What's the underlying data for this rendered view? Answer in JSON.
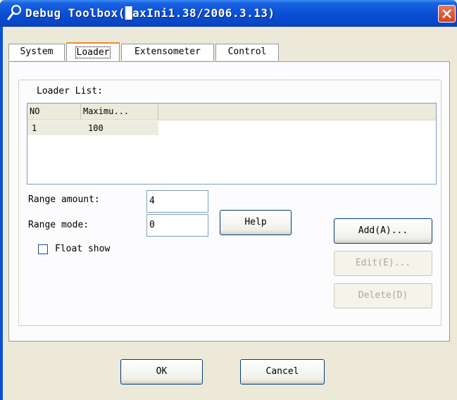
{
  "window": {
    "title": "Debug Toolbox(█axIni1.38/2006.3.13)"
  },
  "tabs": [
    {
      "label": "System",
      "active": false
    },
    {
      "label": "Loader",
      "active": true
    },
    {
      "label": "Extensometer",
      "active": false
    },
    {
      "label": "Control",
      "active": false
    }
  ],
  "loader": {
    "list_label": "Loader List:",
    "columns": [
      "NO",
      "Maximu..."
    ],
    "rows": [
      {
        "no": "1",
        "maximum": "100"
      }
    ],
    "range_amount_label": "Range amount:",
    "range_amount_value": "4",
    "range_mode_label": "Range mode:",
    "range_mode_value": "0",
    "float_show_label": "Float show",
    "float_show_checked": false,
    "help_label": "Help",
    "add_label": "Add(A)...",
    "edit_label": "Edit(E)...",
    "delete_label": "Delete(D)"
  },
  "footer": {
    "ok_label": "OK",
    "cancel_label": "Cancel"
  },
  "colors": {
    "titlebar": "#0a4fd6",
    "close": "#d4421c",
    "tab_highlight": "#e68b2c"
  }
}
